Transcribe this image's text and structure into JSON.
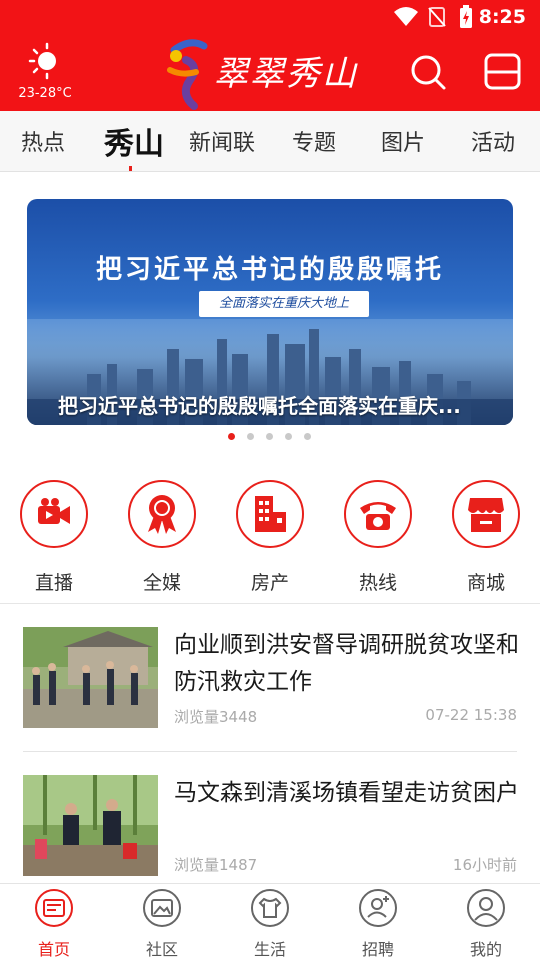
{
  "status_bar": {
    "time": "8:25"
  },
  "header": {
    "weather_temp": "23-28°C",
    "logo_text": "翠翠秀山",
    "colors": {
      "primary": "#f21316",
      "accent": "#e8201b"
    },
    "icons": [
      "weather-sun-icon",
      "search-icon",
      "scan-icon"
    ]
  },
  "tabs": [
    "热点",
    "秀山",
    "新闻联",
    "专题",
    "图片",
    "活动"
  ],
  "active_tab": "秀山",
  "banner": {
    "title": "把习近平总书记的殷殷嘱托",
    "subtitle": "全面落实在重庆大地上",
    "caption": "把习近平总书记的殷殷嘱托全面落实在重庆...",
    "slide_count": 5,
    "active_slide": 1
  },
  "quick_links": [
    {
      "label": "直播",
      "icon": "video-camera-icon"
    },
    {
      "label": "全媒",
      "icon": "ribbon-badge-icon"
    },
    {
      "label": "房产",
      "icon": "building-icon"
    },
    {
      "label": "热线",
      "icon": "telephone-icon"
    },
    {
      "label": "商城",
      "icon": "shop-icon"
    }
  ],
  "news": [
    {
      "title": "向业顺到洪安督导调研脱贫攻坚和防汛救灾工作",
      "views": "浏览量3448",
      "time": "07-22 15:38"
    },
    {
      "title": "马文森到清溪场镇看望走访贫困户",
      "views": "浏览量1487",
      "time": "16小时前"
    }
  ],
  "bottom_nav": [
    {
      "label": "首页",
      "icon": "home-news-icon",
      "active": true
    },
    {
      "label": "社区",
      "icon": "image-gallery-icon",
      "active": false
    },
    {
      "label": "生活",
      "icon": "tshirt-icon",
      "active": false
    },
    {
      "label": "招聘",
      "icon": "person-add-icon",
      "active": false
    },
    {
      "label": "我的",
      "icon": "user-profile-icon",
      "active": false
    }
  ]
}
